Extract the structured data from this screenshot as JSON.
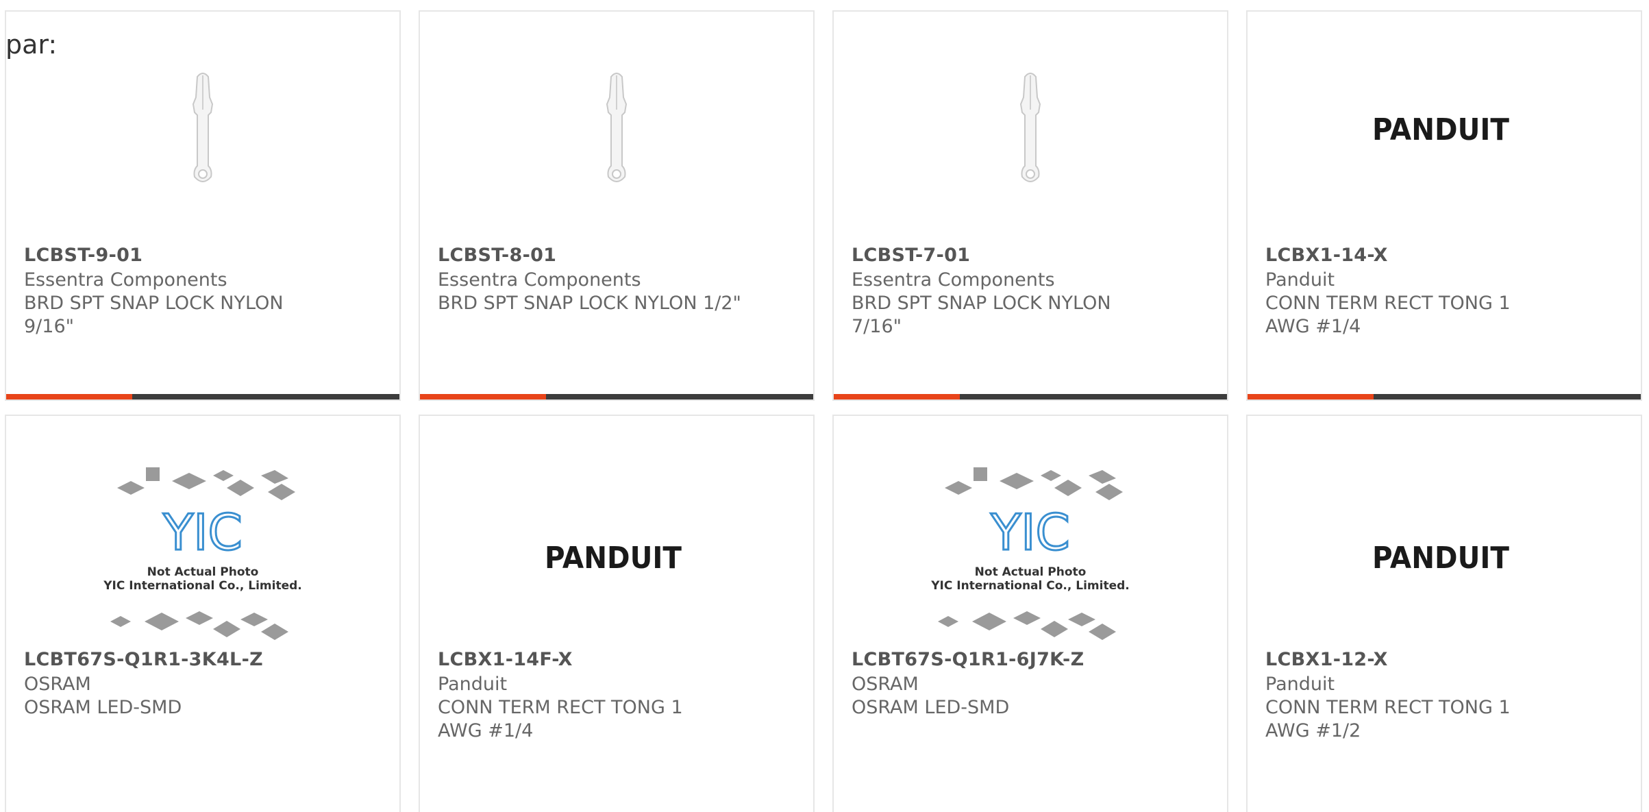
{
  "page_label": "par:",
  "colors": {
    "accent": "#e8441a",
    "bar": "#3d3d3d",
    "border": "#e6e6e6"
  },
  "products": [
    {
      "part": "LCBST-9-01",
      "manufacturer": "Essentra Components",
      "description": "BRD SPT SNAP LOCK NYLON 9/16\"",
      "image": "standoff-icon"
    },
    {
      "part": "LCBST-8-01",
      "manufacturer": "Essentra Components",
      "description": "BRD SPT SNAP LOCK NYLON 1/2\"",
      "image": "standoff-icon"
    },
    {
      "part": "LCBST-7-01",
      "manufacturer": "Essentra Components",
      "description": "BRD SPT SNAP LOCK NYLON 7/16\"",
      "image": "standoff-icon"
    },
    {
      "part": "LCBX1-14-X",
      "manufacturer": "Panduit",
      "description": "CONN TERM RECT TONG 1 AWG #1/4",
      "image": "panduit-logo",
      "logo_text": "PANDUIT"
    },
    {
      "part": "LCBT67S-Q1R1-3K4L-Z",
      "manufacturer": "OSRAM",
      "description": "OSRAM LED-SMD",
      "image": "yic-placeholder",
      "placeholder_line1": "Not Actual Photo",
      "placeholder_line2": "YIC International Co., Limited.",
      "logo_text": "YIC"
    },
    {
      "part": "LCBX1-14F-X",
      "manufacturer": "Panduit",
      "description": "CONN TERM RECT TONG 1 AWG #1/4",
      "image": "panduit-logo",
      "logo_text": "PANDUIT"
    },
    {
      "part": "LCBT67S-Q1R1-6J7K-Z",
      "manufacturer": "OSRAM",
      "description": "OSRAM LED-SMD",
      "image": "yic-placeholder",
      "placeholder_line1": "Not Actual Photo",
      "placeholder_line2": "YIC International Co., Limited.",
      "logo_text": "YIC"
    },
    {
      "part": "LCBX1-12-X",
      "manufacturer": "Panduit",
      "description": "CONN TERM RECT TONG 1 AWG #1/2",
      "image": "panduit-logo",
      "logo_text": "PANDUIT"
    }
  ]
}
